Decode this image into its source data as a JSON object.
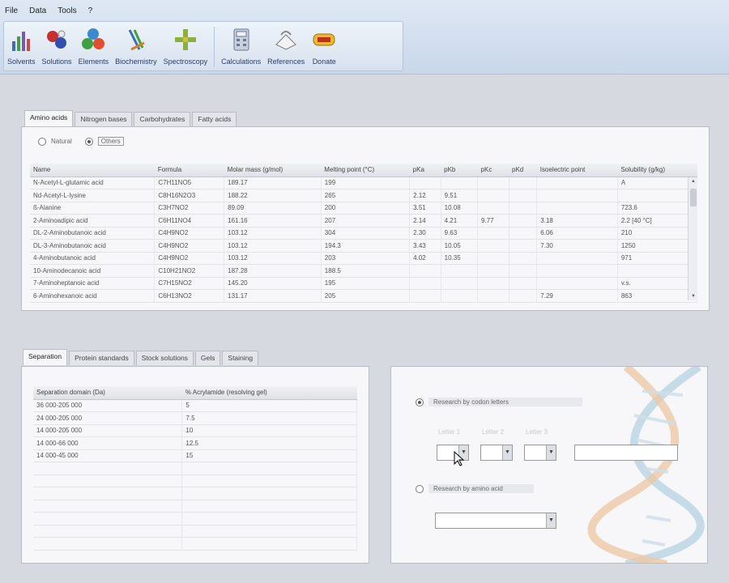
{
  "menu": [
    "File",
    "Data",
    "Tools",
    "?"
  ],
  "toolbar": [
    {
      "label": "Solvents",
      "icon": "flask-icon"
    },
    {
      "label": "Solutions",
      "icon": "solution-molecule-icon"
    },
    {
      "label": "Elements",
      "icon": "elements-icon"
    },
    {
      "label": "Biochemistry",
      "icon": "biochemistry-icon"
    },
    {
      "label": "Spectroscopy",
      "icon": "spectroscopy-icon"
    },
    {
      "label": "Calculations",
      "icon": "calculator-icon"
    },
    {
      "label": "References",
      "icon": "references-icon"
    },
    {
      "label": "Donate",
      "icon": "donate-icon"
    }
  ],
  "amino_panel": {
    "tabs": [
      "Amino acids",
      "Nitrogen bases",
      "Carbohydrates",
      "Fatty acids"
    ],
    "active_tab": 0,
    "radios": [
      {
        "label": "Natural",
        "checked": false
      },
      {
        "label": "Others",
        "checked": true
      }
    ],
    "columns": [
      "Name",
      "Formula",
      "Molar mass (g/mol)",
      "Melting point (°C)",
      "pKa",
      "pKb",
      "pKc",
      "pKd",
      "Isoelectric point",
      "Solubility (g/kg)"
    ],
    "rows": [
      [
        "N-Acetyl-L-glutamic acid",
        "C7H11NO5",
        "189.17",
        "199",
        "",
        "",
        "",
        "",
        "",
        "A"
      ],
      [
        "Nd-Acetyl-L-lysine",
        "C8H16N2O3",
        "188.22",
        "265",
        "2.12",
        "9.51",
        "",
        "",
        "",
        ""
      ],
      [
        "ß-Alanine",
        "C3H7NO2",
        "89.09",
        "200",
        "3.51",
        "10.08",
        "",
        "",
        "",
        "723.6"
      ],
      [
        "2-Aminoadipic acid",
        "C6H11NO4",
        "161.16",
        "207",
        "2.14",
        "4.21",
        "9.77",
        "",
        "3.18",
        "2.2 [40 °C]"
      ],
      [
        "DL-2-Aminobutanoic acid",
        "C4H9NO2",
        "103.12",
        "304",
        "2.30",
        "9.63",
        "",
        "",
        "6.06",
        "210"
      ],
      [
        "DL-3-Aminobutanoic acid",
        "C4H9NO2",
        "103.12",
        "194.3",
        "3.43",
        "10.05",
        "",
        "",
        "7.30",
        "1250"
      ],
      [
        "4-Aminobutanoic acid",
        "C4H9NO2",
        "103.12",
        "203",
        "4.02",
        "10.35",
        "",
        "",
        "",
        "971"
      ],
      [
        "10-Aminodecanoic acid",
        "C10H21NO2",
        "187.28",
        "188.5",
        "",
        "",
        "",
        "",
        "",
        ""
      ],
      [
        "7-Aminoheptanoic acid",
        "C7H15NO2",
        "145.20",
        "195",
        "",
        "",
        "",
        "",
        "",
        "v.s."
      ],
      [
        "6-Aminohexanoic acid",
        "C6H13NO2",
        "131.17",
        "205",
        "",
        "",
        "",
        "",
        "7.29",
        "863"
      ]
    ]
  },
  "sep_panel": {
    "tabs": [
      "Separation",
      "Protein standards",
      "Stock solutions",
      "Gels",
      "Staining"
    ],
    "active_tab": 0,
    "columns": [
      "Separation domain (Da)",
      "% Acrylamide (resolving gel)"
    ],
    "rows": [
      [
        "36 000-205 000",
        "5"
      ],
      [
        "24 000-205 000",
        "7.5"
      ],
      [
        "14 000-205 000",
        "10"
      ],
      [
        "14 000-66 000",
        "12.5"
      ],
      [
        "14 000-45 000",
        "15"
      ],
      [
        "",
        ""
      ],
      [
        "",
        ""
      ],
      [
        "",
        ""
      ],
      [
        "",
        ""
      ],
      [
        "",
        ""
      ],
      [
        "",
        ""
      ],
      [
        "",
        ""
      ]
    ]
  },
  "search_panel": {
    "by_letters_label": "Research by codon letters",
    "by_amino_label": "Research by amino acid",
    "letter_labels": [
      "Letter 1",
      "Letter 2",
      "Letter 3"
    ],
    "result_value": "",
    "amino_value": ""
  },
  "colors": {
    "accent": "#2a3c6a",
    "panel": "#f7f7f9",
    "bg": "#d6d9e0"
  }
}
